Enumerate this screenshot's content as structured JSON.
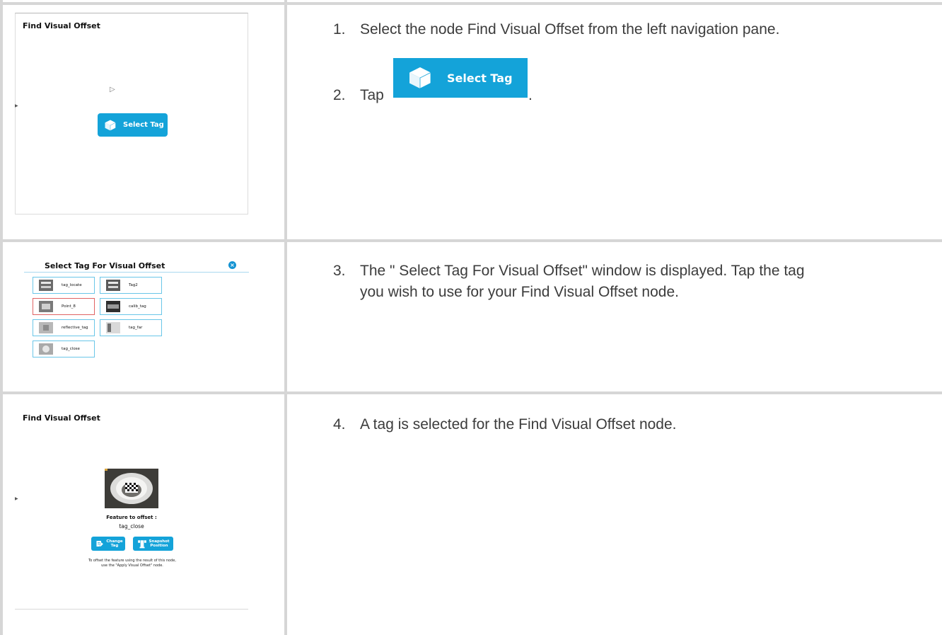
{
  "step1": {
    "panel_title": "Find Visual Offset",
    "button_label": "Select Tag",
    "instruction_number": "1.",
    "instruction_text": "Select the node Find Visual Offset from the left navigation pane.",
    "instruction2_number": "2.",
    "instruction2_prefix": "Tap",
    "instruction2_suffix": ".",
    "big_button_label": "Select Tag"
  },
  "step3": {
    "dialog_title": "Select Tag For Visual Offset",
    "close_icon": "×",
    "tags": [
      {
        "name": "tag_locate",
        "selected": false
      },
      {
        "name": "Tag2",
        "selected": false
      },
      {
        "name": "Point_8",
        "selected": true
      },
      {
        "name": "calib_tag",
        "selected": false
      },
      {
        "name": "reflective_tag",
        "selected": false
      },
      {
        "name": "tag_far",
        "selected": false
      },
      {
        "name": "tag_close",
        "selected": false
      }
    ],
    "instruction_number": "3.",
    "instruction_line1": "The \" Select Tag For Visual Offset\"  window is displayed. Tap the tag",
    "instruction_line2": "you wish to use for your Find Visual Offset node."
  },
  "step4": {
    "panel_title": "Find Visual Offset",
    "feature_label": "Feature to offset :",
    "feature_value": "tag_close",
    "change_tag_label": "Change Tag",
    "snapshot_label": "Snapshot Position",
    "note_line1": "To offset the feature using the result of this node,",
    "note_line2": "use the \"Apply Visual Offset\" node.",
    "instruction_number": "4.",
    "instruction_text": "A tag is selected for the Find Visual Offset node."
  },
  "colors": {
    "accent": "#14a3d9",
    "grid_line": "#d6d6d6",
    "selected_border": "#e06363"
  }
}
